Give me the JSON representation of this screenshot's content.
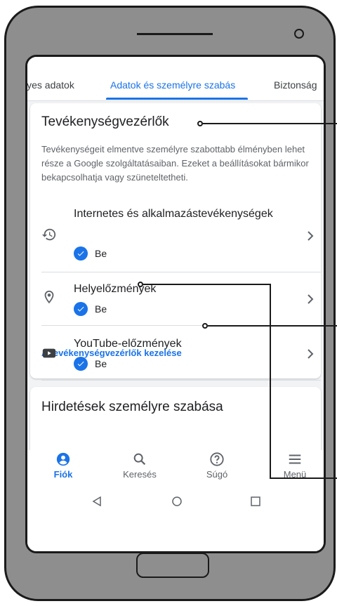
{
  "tabs": [
    {
      "label": "lyes adatok"
    },
    {
      "label": "Adatok és személyre szabás"
    },
    {
      "label": "Biztonság"
    }
  ],
  "activity": {
    "title": "Tevékenységvezérlők",
    "description": "Tevékenységeit elmentve személyre szabottabb élményben lehet része a Google szolgáltatásaiban. Ezeket a beállításokat bármikor bekapcsolhatja vagy szüneteltetheti.",
    "items": [
      {
        "title": "Internetes és alkalmazástevékenységek",
        "status": "Be",
        "icon": "history-icon"
      },
      {
        "title": "Helyelőzmények",
        "status": "Be",
        "icon": "location-pin-icon"
      },
      {
        "title": "YouTube-előzmények",
        "status": "Be",
        "icon": "youtube-icon"
      }
    ],
    "manage_link": "A tevékenységvezérlők kezelése"
  },
  "ads": {
    "title": "Hirdetések személyre szabása"
  },
  "bottom_nav": [
    {
      "label": "Fiók",
      "icon": "account-icon"
    },
    {
      "label": "Keresés",
      "icon": "search-icon"
    },
    {
      "label": "Súgó",
      "icon": "help-icon"
    },
    {
      "label": "Menü",
      "icon": "menu-icon"
    }
  ],
  "colors": {
    "accent": "#1a73e8",
    "text": "#202124",
    "secondary": "#5f6368"
  }
}
